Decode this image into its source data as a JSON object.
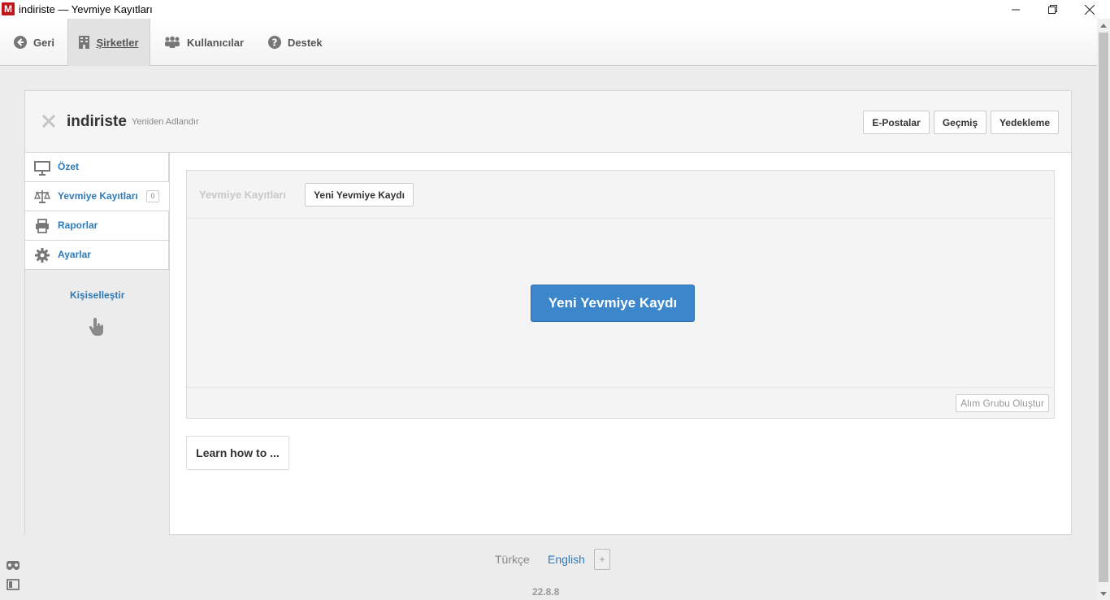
{
  "window": {
    "logo_letter": "M",
    "title": "indiriste — Yevmiye Kayıtları"
  },
  "topnav": {
    "items": [
      {
        "label": "Geri",
        "icon": "arrow-left-circle-icon"
      },
      {
        "label": "Şirketler",
        "icon": "building-icon"
      },
      {
        "label": "Kullanıcılar",
        "icon": "users-icon"
      },
      {
        "label": "Destek",
        "icon": "question-circle-icon"
      }
    ]
  },
  "header": {
    "company_name": "indiriste",
    "rename_label": "Yeniden Adlandır",
    "buttons": {
      "emails": "E-Postalar",
      "history": "Geçmiş",
      "backup": "Yedekleme"
    }
  },
  "sidebar": {
    "items": [
      {
        "label": "Özet",
        "icon": "presentation-icon"
      },
      {
        "label": "Yevmiye Kayıtları",
        "icon": "scale-icon",
        "badge": "0"
      },
      {
        "label": "Raporlar",
        "icon": "printer-icon"
      },
      {
        "label": "Ayarlar",
        "icon": "gear-icon"
      }
    ],
    "customize_label": "Kişiselleştir"
  },
  "journal": {
    "title": "Yevmiye Kayıtları",
    "new_entry_small": "Yeni Yevmiye Kaydı",
    "new_entry_big": "Yeni Yevmiye Kaydı",
    "group_button": "Alım Grubu Oluştur"
  },
  "learn": {
    "label": "Learn how to ..."
  },
  "footer": {
    "lang_tr": "Türkçe",
    "lang_en": "English",
    "lang_add": "+",
    "version": "22.8.8"
  },
  "colors": {
    "accent": "#3c86cb",
    "link": "#2f7ab8",
    "logo": "#c2171a"
  }
}
